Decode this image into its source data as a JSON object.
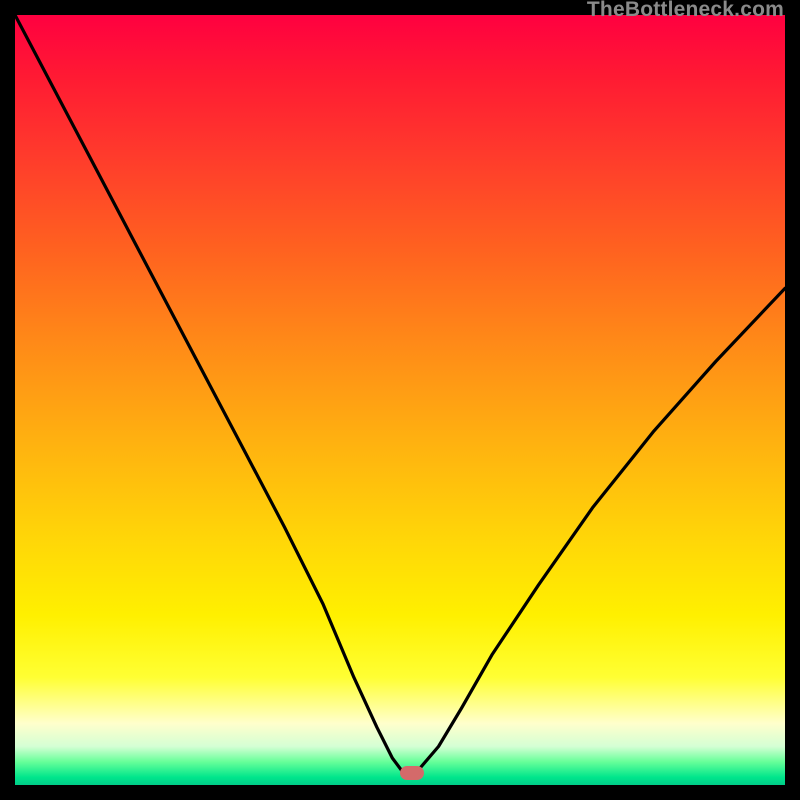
{
  "watermark": "TheBottleneck.com",
  "marker": {
    "x_frac": 0.515,
    "y_frac": 0.985
  },
  "chart_data": {
    "type": "line",
    "title": "",
    "xlabel": "",
    "ylabel": "",
    "xlim": [
      0,
      1
    ],
    "ylim": [
      0,
      1
    ],
    "series": [
      {
        "name": "bottleneck-curve",
        "x": [
          0.0,
          0.05,
          0.1,
          0.15,
          0.2,
          0.25,
          0.3,
          0.35,
          0.4,
          0.44,
          0.47,
          0.49,
          0.505,
          0.52,
          0.55,
          0.58,
          0.62,
          0.68,
          0.75,
          0.83,
          0.91,
          1.0
        ],
        "y": [
          1.0,
          0.905,
          0.81,
          0.715,
          0.62,
          0.525,
          0.43,
          0.335,
          0.235,
          0.14,
          0.075,
          0.035,
          0.015,
          0.015,
          0.05,
          0.1,
          0.17,
          0.26,
          0.36,
          0.46,
          0.55,
          0.645
        ]
      }
    ],
    "gradient_stops": [
      {
        "pos": 0.0,
        "color": "#ff0040"
      },
      {
        "pos": 0.5,
        "color": "#ffc010"
      },
      {
        "pos": 0.8,
        "color": "#ffff33"
      },
      {
        "pos": 0.95,
        "color": "#d4ffd4"
      },
      {
        "pos": 1.0,
        "color": "#00cc88"
      }
    ]
  }
}
